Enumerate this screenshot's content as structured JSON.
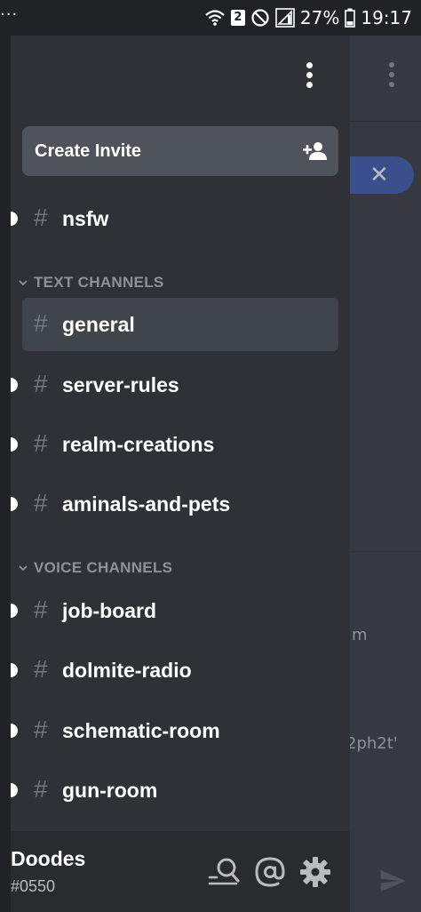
{
  "status_bar": {
    "left_indicator": "···",
    "sim_badge": "2",
    "battery_percent": "27%",
    "time": "19:17"
  },
  "drawer": {
    "invite_label": "Create Invite",
    "top_channel": {
      "name": "nsfw",
      "unread": true
    },
    "categories": [
      {
        "label": "TEXT CHANNELS"
      },
      {
        "label": "VOICE CHANNELS"
      }
    ],
    "text_channels": [
      {
        "name": "general",
        "selected": true,
        "unread": false
      },
      {
        "name": "server-rules",
        "unread": true
      },
      {
        "name": "realm-creations",
        "unread": true
      },
      {
        "name": "aminals-and-pets",
        "unread": true
      }
    ],
    "voice_channels": [
      {
        "name": "job-board",
        "unread": true
      },
      {
        "name": "dolmite-radio",
        "unread": true
      },
      {
        "name": "schematic-room",
        "unread": true
      },
      {
        "name": "gun-room",
        "unread": true
      }
    ]
  },
  "user": {
    "name": "Doodes",
    "discriminator": "#0550"
  },
  "background_chat": {
    "fragment_1": "m",
    "fragment_2": "2ph2t'"
  },
  "colors": {
    "drawer_bg": "#2f3136",
    "selected_bg": "#40444b",
    "invite_bg": "#4f545c",
    "panel_bg": "#292b2f",
    "category_text": "#8e9297",
    "hash_color": "#72767d",
    "accent_pill": "#3b4f8c"
  },
  "icons": {
    "invite": "add-person-icon",
    "overflow": "kebab-menu-icon",
    "search": "search-icon",
    "mentions": "at-sign-icon",
    "settings": "gear-icon",
    "send": "send-arrow-icon",
    "close": "close-icon"
  }
}
